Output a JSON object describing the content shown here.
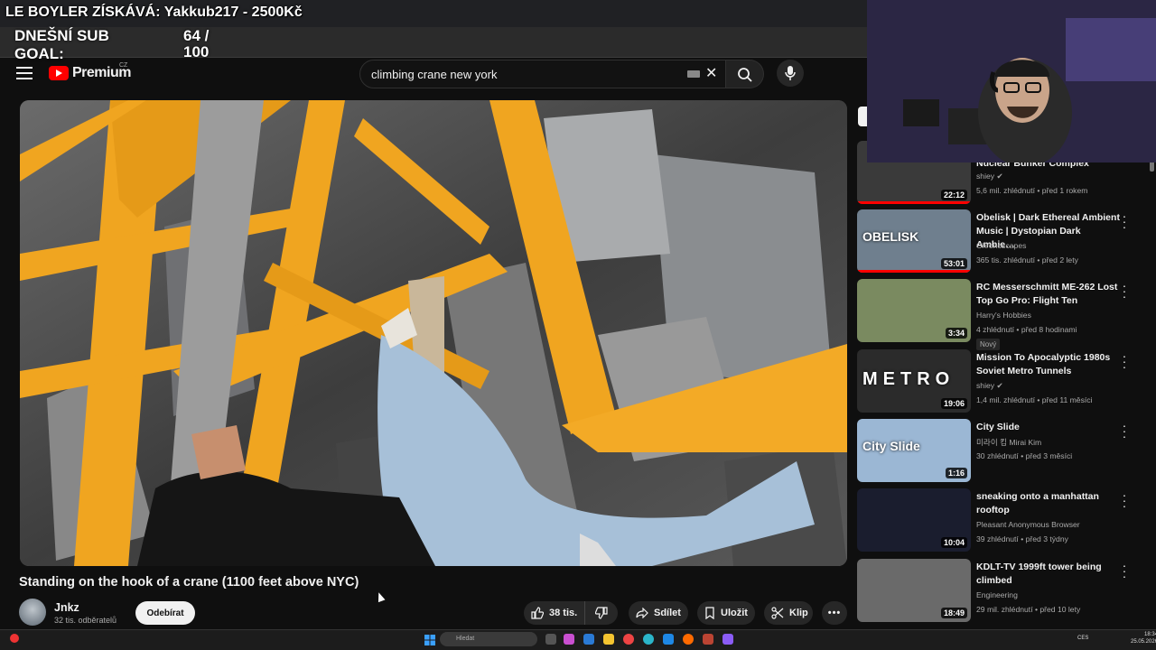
{
  "overlay": {
    "donation": "LE BOYLER ZÍSKÁVÁ: Yakkub217 - 2500Kč",
    "goal_label": "DNEŠNÍ SUB GOAL:",
    "goal_value": "64 / 100"
  },
  "header": {
    "logo_text": "Premium",
    "logo_region": "CZ",
    "search_value": "climbing crane new york"
  },
  "video": {
    "title": "Standing on the hook of a crane (1100 feet above NYC)",
    "channel": "Jnkz",
    "subscribers": "32 tis. odběratelů",
    "subscribe_label": "Odebírat",
    "likes": "38 tis.",
    "share_label": "Sdílet",
    "save_label": "Uložit",
    "clip_label": "Klip",
    "more_label": "•••"
  },
  "recommendations": [
    {
      "title": "Nuclear Bunker Complex",
      "channel": "shiey ✔",
      "meta": "5,6 mil. zhlédnutí • před 1 rokem",
      "duration": "22:12",
      "thumb_label": "",
      "badge": "",
      "progress": 1.0
    },
    {
      "title": "Obelisk | Dark Ethereal Ambient Music | Dystopian Dark Ambie…",
      "channel": "Chronoscapes",
      "meta": "365 tis. zhlédnutí • před 2 lety",
      "duration": "53:01",
      "thumb_label": "OBELISK",
      "badge": "",
      "progress": 1.0
    },
    {
      "title": "RC Messerschmitt ME-262 Lost Top Go Pro: Flight Ten",
      "channel": "Harry's Hobbies",
      "meta": "4 zhlédnutí • před 8 hodinami",
      "duration": "3:34",
      "thumb_label": "",
      "badge": "Nový",
      "progress": 0
    },
    {
      "title": "Mission To Apocalyptic 1980s Soviet Metro Tunnels",
      "channel": "shiey ✔",
      "meta": "1,4 mil. zhlédnutí • před 11 měsíci",
      "duration": "19:06",
      "thumb_label": "METRO",
      "badge": "",
      "progress": 0
    },
    {
      "title": "City Slide",
      "channel": "미라이 킴 Mirai Kim",
      "meta": "30 zhlédnutí • před 3 měsíci",
      "duration": "1:16",
      "thumb_label": "City Slide",
      "badge": "",
      "progress": 0
    },
    {
      "title": "sneaking onto a manhattan rooftop",
      "channel": "Pleasant Anonymous Browser",
      "meta": "39 zhlédnutí • před 3 týdny",
      "duration": "10:04",
      "thumb_label": "",
      "badge": "",
      "progress": 0
    },
    {
      "title": "KDLT-TV 1999ft tower being climbed",
      "channel": "Engineering",
      "meta": "29 mil. zhlédnutí • před 10 lety",
      "duration": "18:49",
      "thumb_label": "",
      "badge": "",
      "progress": 0
    }
  ],
  "taskbar": {
    "search_placeholder": "Hledat",
    "language": "CES",
    "time": "18:34",
    "date": "25.05.2026"
  },
  "colors": {
    "accent": "#ff0000",
    "crane": "#f0a520",
    "background": "#0f0f0f"
  }
}
